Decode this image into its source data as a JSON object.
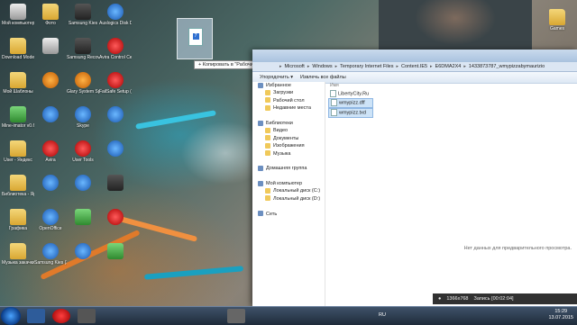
{
  "desktop": {
    "left_icons": [
      {
        "label": "Мой компьютер",
        "type": "gray"
      },
      {
        "label": "Download Mode",
        "type": "folder"
      },
      {
        "label": "Мой Шаблоны",
        "type": "folder"
      },
      {
        "label": "Mine-imator v0.6.2",
        "type": "green"
      },
      {
        "label": "User - Яндекс",
        "type": "folder"
      },
      {
        "label": "Библиотека - Ярлык (3)",
        "type": "folder"
      },
      {
        "label": "Графика",
        "type": "folder"
      },
      {
        "label": "Музыка закачки",
        "type": "folder"
      }
    ],
    "col2_icons": [
      {
        "label": "Фото",
        "type": "folder"
      },
      {
        "label": "",
        "type": "gray"
      },
      {
        "label": "",
        "type": "orange"
      },
      {
        "label": "",
        "type": "blue"
      },
      {
        "label": "Avira",
        "type": "red"
      },
      {
        "label": "",
        "type": "blue"
      },
      {
        "label": "OpenOffice",
        "type": "blue"
      },
      {
        "label": "Samsung Kies (3)",
        "type": "blue"
      }
    ],
    "col3_icons": [
      {
        "label": "Samsung Kies",
        "type": "dark"
      },
      {
        "label": "Samsung Recover...",
        "type": "dark"
      },
      {
        "label": "Glary System Speedup",
        "type": "orange"
      },
      {
        "label": "Skype",
        "type": "blue"
      },
      {
        "label": "User Tools",
        "type": "red"
      },
      {
        "label": "",
        "type": "blue"
      },
      {
        "label": "",
        "type": "green"
      },
      {
        "label": "",
        "type": "blue"
      }
    ],
    "col4_icons": [
      {
        "label": "Auslogics Disk Defr...",
        "type": "blue"
      },
      {
        "label": "Avira Control Center",
        "type": "red"
      },
      {
        "label": "FailSafe Setup (5)",
        "type": "red"
      },
      {
        "label": "",
        "type": "blue"
      },
      {
        "label": "",
        "type": "blue"
      },
      {
        "label": "",
        "type": "dark"
      },
      {
        "label": "",
        "type": "red"
      },
      {
        "label": "",
        "type": "green"
      }
    ],
    "right_icon": {
      "label": "Games",
      "type": "folder"
    },
    "drag_tooltip": "+ Копировать в \"Рабочий стол\"",
    "ghost_glyph": "7"
  },
  "explorer": {
    "breadcrumb": [
      "Microsoft",
      "Windows",
      "Temporary Internet Files",
      "Content.IE5",
      "E6DMA2X4",
      "1433873787_wmypizzabymaurizio"
    ],
    "toolbar": {
      "organize": "Упорядочить ▾",
      "extract": "Извлечь все файлы"
    },
    "nav": [
      {
        "label": "Избранное",
        "group": true
      },
      {
        "label": "Загрузки",
        "group": false
      },
      {
        "label": "Рабочий стол",
        "group": false
      },
      {
        "label": "Недавние места",
        "group": false
      },
      {
        "label": "",
        "group": false
      },
      {
        "label": "Библиотеки",
        "group": true
      },
      {
        "label": "Видео",
        "group": false
      },
      {
        "label": "Документы",
        "group": false
      },
      {
        "label": "Изображения",
        "group": false
      },
      {
        "label": "Музыка",
        "group": false
      },
      {
        "label": "",
        "group": false
      },
      {
        "label": "Домашняя группа",
        "group": true
      },
      {
        "label": "",
        "group": false
      },
      {
        "label": "Мой компьютер",
        "group": true
      },
      {
        "label": "Локальный диск (C:)",
        "group": false
      },
      {
        "label": "Локальный диск (D:)",
        "group": false
      },
      {
        "label": "",
        "group": false
      },
      {
        "label": "Сеть",
        "group": true
      }
    ],
    "files_header": "Имя",
    "files": [
      "LibertyCity.Ru",
      "wmypizz.dff",
      "wmypizz.txd"
    ],
    "preview_text": "Нет данных для предварительного просмотра."
  },
  "recorder": {
    "resolution": "1366x768",
    "status": "Запись [00:02:04]"
  },
  "taskbar": {
    "lang": "RU",
    "time": "15:29",
    "date": "13.07.2015"
  }
}
